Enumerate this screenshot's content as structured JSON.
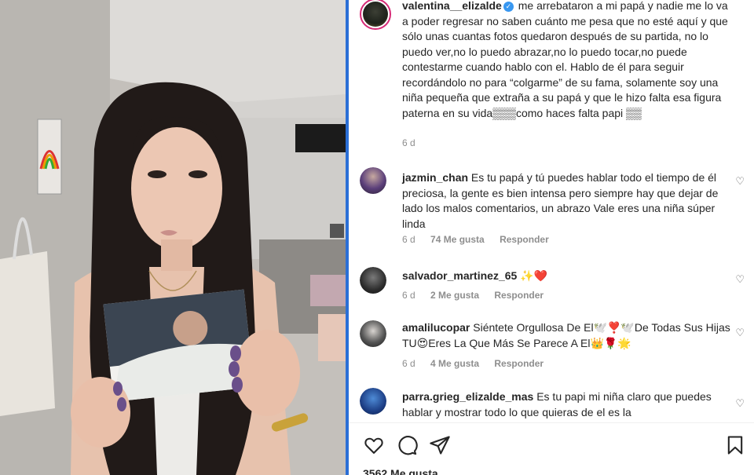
{
  "post": {
    "likes": "3562 Me gusta",
    "caption": {
      "username": "valentina__elizalde",
      "text": "me arrebataron a mi papá y nadie me lo va a poder regresar no saben cuánto me pesa que no esté aquí y que sólo unas cuantas fotos quedaron después de su partida, no lo puedo ver,no lo puedo abrazar,no lo puedo tocar,no puede contestarme cuando hablo con el. Hablo de él para seguir recordándolo no para “colgarme” de su fama, solamente soy una niña pequeña que extraña a su papá y que le hizo falta esa figura paterna en su vida▒▒▒como haces falta papi ▒▒",
      "time": "6 d"
    }
  },
  "comments": [
    {
      "username": "jazmin_chan",
      "text": "Es tu papá y tú puedes hablar todo el tiempo de él preciosa, la gente es bien intensa pero siempre hay que dejar de lado los malos comentarios, un abrazo Vale eres una niña súper linda",
      "time": "6 d",
      "likes": "74 Me gusta",
      "reply": "Responder"
    },
    {
      "username": "salvador_martinez_65",
      "text": "✨❤️",
      "time": "6 d",
      "likes": "2 Me gusta",
      "reply": "Responder"
    },
    {
      "username": "amalilucopar",
      "text": "Siéntete Orgullosa De El🕊️❣️🕊️De Todas Sus Hijas TU😍Eres La Que Más Se Parece A El👑🌹🌟",
      "time": "6 d",
      "likes": "4 Me gusta",
      "reply": "Responder"
    },
    {
      "username": "parra.grieg_elizalde_mas",
      "text": "Es tu papi mi niña claro que puedes hablar y mostrar todo lo que quieras de el es la",
      "time": "",
      "likes": "",
      "reply": ""
    }
  ],
  "icons": {
    "like": "heart-icon",
    "comment": "comment-icon",
    "share": "share-icon",
    "save": "bookmark-icon",
    "verified": "verified-badge-icon"
  },
  "colors": {
    "story_ring": "#d62976",
    "verified": "#3897f0",
    "meta_text": "#8e8e8e",
    "divider": "#2b6fd6"
  }
}
